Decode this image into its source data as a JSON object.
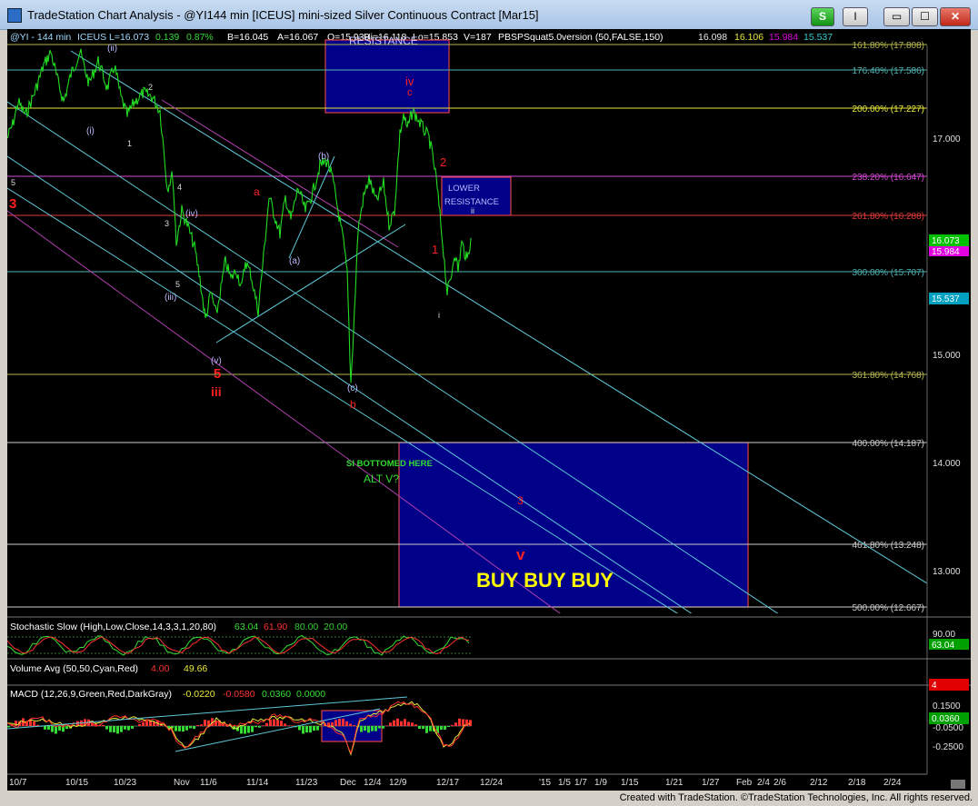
{
  "window": {
    "title": "TradeStation Chart Analysis - @YI144 min [ICEUS] mini-sized Silver Continuous Contract [Mar15]",
    "strategy_button": "S",
    "menu_button": "I",
    "min_glyph": "▭",
    "max_glyph": "☐",
    "close_glyph": "✕"
  },
  "header": {
    "symbol": "@YI - 144 min",
    "exchange": "ICEUS",
    "last": "L=16.073",
    "change": "0.139",
    "change_pct": "0.87%",
    "bid": "B=16.045",
    "ask": "A=16.067",
    "open": "O=15.930",
    "high": "Hi=16.118",
    "low": "Lo=15.853",
    "volume": "V=187",
    "indicator": "PBSPSquat5.0version (50,FALSE,150)",
    "ind_v1": "16.098",
    "ind_v2": "16.106",
    "ind_v3": "15.984",
    "ind_v4": "15.537"
  },
  "fib_levels": [
    {
      "label": "161.80% (17.808)",
      "color": "#b5b54d"
    },
    {
      "label": "176.40% (17.586)",
      "color": "#4fb3b3"
    },
    {
      "label": "200.00% (17.227)",
      "color": "#e8e83a"
    },
    {
      "label": "238.20% (16.647)",
      "color": "#d64ad6"
    },
    {
      "label": "261.80% (16.288)",
      "color": "#e03a3a"
    },
    {
      "label": "300.00% (15.707)",
      "color": "#4fb3b3"
    },
    {
      "label": "361.80% (14.768)",
      "color": "#b5b54d"
    },
    {
      "label": "400.00% (14.187)",
      "color": "#cccccc"
    },
    {
      "label": "461.80% (13.248)",
      "color": "#cccccc"
    },
    {
      "label": "500.00% (12.667)",
      "color": "#cccccc"
    }
  ],
  "price_axis": [
    "17.000",
    "15.000",
    "14.000",
    "13.000"
  ],
  "price_markers": [
    {
      "value": "16.073",
      "color": "#00c000"
    },
    {
      "value": "15.984",
      "color": "#e000e0"
    },
    {
      "value": "15.537",
      "color": "#00a0c0"
    }
  ],
  "annotations": {
    "resistance": "RESISTANCE",
    "lower_resistance_1": "LOWER",
    "lower_resistance_2": "RESISTANCE",
    "si_bottomed": "SI BOTTOMED HERE",
    "alt_v": "ALT V?",
    "buy": "BUY BUY BUY",
    "red_3_target": "3",
    "red_v_target": "v"
  },
  "wave_labels": {
    "ii_paren": "(ii)",
    "i_paren": "(i)",
    "iii_paren": "(iii)",
    "iv_paren": "(iv)",
    "v_paren": "(v)",
    "a_paren": "(a)",
    "b_paren": "(b)",
    "c_paren": "(c)",
    "five_red": "5",
    "iii_red": "iii",
    "iv_red": "iv",
    "c_red": "c",
    "b_red": "b",
    "a_red": "a",
    "two_red": "2",
    "one_red": "1",
    "three_red": "3",
    "small_i": "i",
    "small_ii": "ii",
    "w1": "1",
    "w2": "2",
    "w3": "3",
    "w4": "4",
    "w5": "5",
    "w5b": "5",
    "w5c": "5"
  },
  "stochastic": {
    "title": "Stochastic Slow (High,Low,Close,14,3,3,1,20,80)",
    "v1": "63.04",
    "v2": "61.90",
    "v3": "80.00",
    "v4": "20.00",
    "axis_top": "90.00",
    "marker": "63.04"
  },
  "volume": {
    "title": "Volume Avg (50,50,Cyan,Red)",
    "v1": "4.00",
    "v2": "49.66",
    "marker": "4"
  },
  "macd": {
    "title": "MACD (12,26,9,Green,Red,DarkGray)",
    "v1": "-0.0220",
    "v2": "-0.0580",
    "v3": "0.0360",
    "v4": "0.0000",
    "axis1": "0.1500",
    "marker": "0.0360",
    "axis2": "-0.0500",
    "axis3": "-0.2500"
  },
  "time_axis": [
    "10/7",
    "10/15",
    "10/23",
    "Nov",
    "11/6",
    "11/14",
    "11/23",
    "Dec",
    "12/4",
    "12/9",
    "12/17",
    "12/24",
    "'15",
    "1/5",
    "1/7",
    "1/9",
    "1/15",
    "1/21",
    "1/27",
    "Feb",
    "2/4",
    "2/6",
    "2/12",
    "2/18",
    "2/24"
  ],
  "footer": "Created with TradeStation. ©TradeStation Technologies, Inc. All rights reserved."
}
